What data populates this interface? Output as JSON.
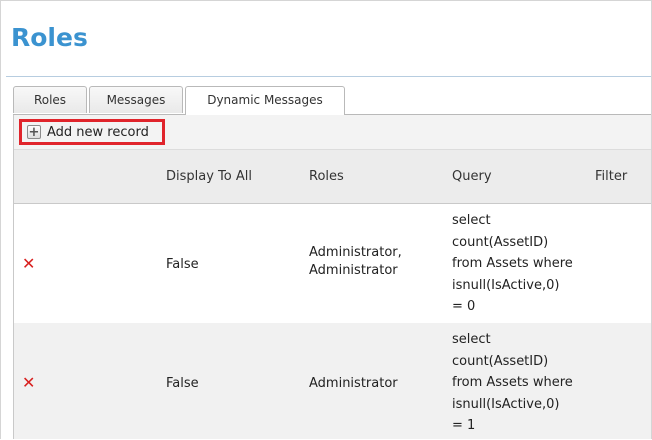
{
  "page": {
    "title": "Roles"
  },
  "tabs": [
    {
      "label": "Roles",
      "active": false
    },
    {
      "label": "Messages",
      "active": false
    },
    {
      "label": "Dynamic Messages",
      "active": true
    }
  ],
  "toolbar": {
    "add_label": "Add new record",
    "add_icon": "plus-icon"
  },
  "grid": {
    "columns": [
      "",
      "Display To All",
      "Roles",
      "Query",
      "Filter"
    ],
    "rows": [
      {
        "delete_icon": "delete-x-icon",
        "display_to_all": "False",
        "roles_line1": "Administrator,",
        "roles_line2": "Administrator",
        "query_lines": [
          "select",
          "count(AssetID)",
          "from Assets where",
          "isnull(IsActive,0)",
          "= 0"
        ],
        "filter": ""
      },
      {
        "delete_icon": "delete-x-icon",
        "display_to_all": "False",
        "roles_line1": "Administrator",
        "roles_line2": "",
        "query_lines": [
          "select",
          "count(AssetID)",
          "from Assets where",
          "isnull(IsActive,0)",
          "= 1"
        ],
        "filter": ""
      }
    ]
  },
  "colors": {
    "title": "#3b93d0",
    "highlight": "#e0242b",
    "delete": "#d8201f"
  }
}
